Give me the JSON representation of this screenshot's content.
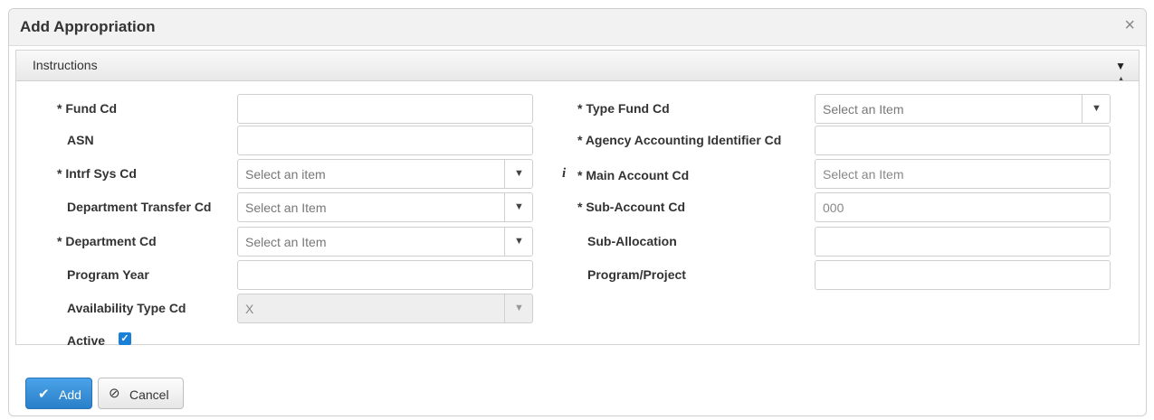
{
  "dialog": {
    "title": "Add Appropriation",
    "close_glyph": "×"
  },
  "instructions": {
    "label": "Instructions"
  },
  "left_fields": {
    "fund_cd": {
      "label": "* Fund Cd",
      "value": ""
    },
    "asn": {
      "label": "ASN",
      "value": ""
    },
    "intrf_sys_cd": {
      "label": "* Intrf Sys Cd",
      "placeholder": "Select an item"
    },
    "dept_transfer_cd": {
      "label": "Department Transfer Cd",
      "placeholder": "Select an Item"
    },
    "department_cd": {
      "label": "* Department Cd",
      "placeholder": "Select an Item"
    },
    "program_year": {
      "label": "Program Year",
      "value": ""
    },
    "availability_type_cd": {
      "label": "Availability Type Cd",
      "value": "X"
    },
    "active": {
      "label": "Active",
      "checked": true
    }
  },
  "right_fields": {
    "type_fund_cd": {
      "label": "* Type Fund Cd",
      "placeholder": "Select an Item"
    },
    "agency_accounting_id_cd": {
      "label": "* Agency Accounting Identifier Cd",
      "value": ""
    },
    "main_account_cd": {
      "label": "* Main Account Cd",
      "placeholder": "Select an Item",
      "info_glyph": "i"
    },
    "sub_account_cd": {
      "label": "* Sub-Account Cd",
      "placeholder": "000"
    },
    "sub_allocation": {
      "label": "Sub-Allocation",
      "value": ""
    },
    "program_project": {
      "label": "Program/Project",
      "value": ""
    }
  },
  "footer": {
    "add_label": "Add",
    "cancel_label": "Cancel"
  },
  "colors": {
    "primary": "#2a7fc9",
    "checkbox": "#1a7fd6"
  }
}
